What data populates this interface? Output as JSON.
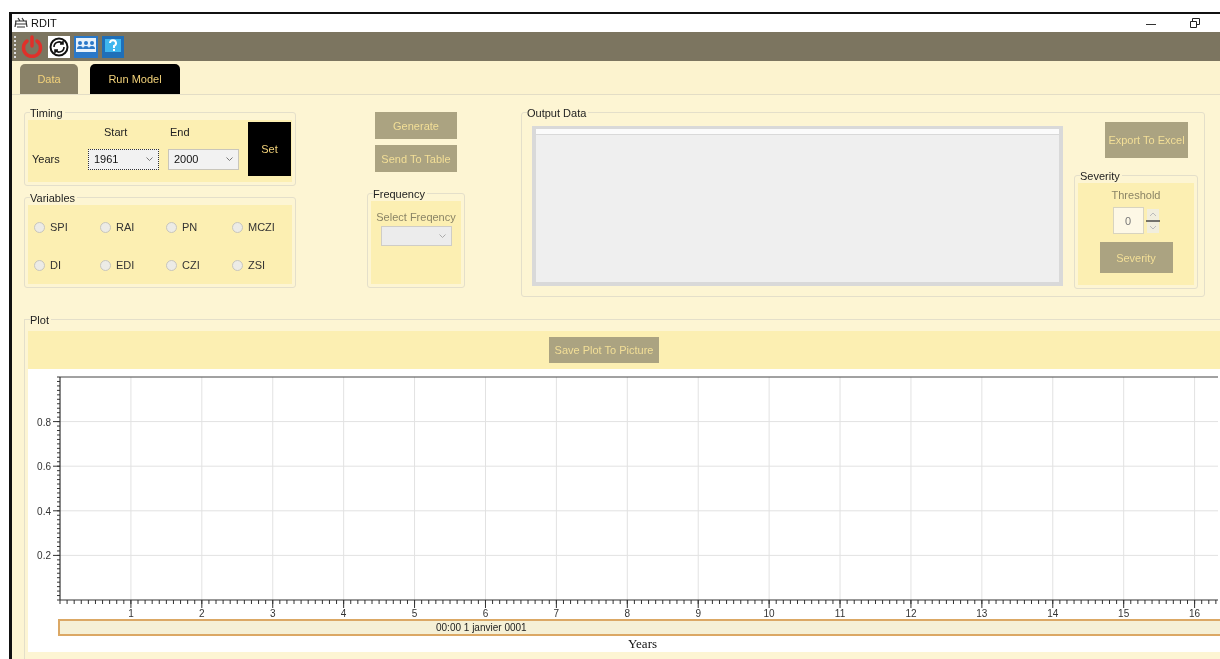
{
  "window": {
    "title": "RDIT"
  },
  "tabs": [
    {
      "label": "Data",
      "selected": false
    },
    {
      "label": "Run Model",
      "selected": true
    }
  ],
  "timing": {
    "title": "Timing",
    "start_label": "Start",
    "end_label": "End",
    "row_label": "Years",
    "start": {
      "value": "1961",
      "focused": true
    },
    "end": {
      "value": "2000",
      "focused": false
    },
    "set_button": {
      "label": "Set",
      "disabled": false
    }
  },
  "variables": {
    "title": "Variables",
    "options": [
      {
        "label": "SPI",
        "selected": false
      },
      {
        "label": "RAI",
        "selected": false
      },
      {
        "label": "PN",
        "selected": false
      },
      {
        "label": "MCZI",
        "selected": false
      },
      {
        "label": "DI",
        "selected": false
      },
      {
        "label": "EDI",
        "selected": false
      },
      {
        "label": "CZI",
        "selected": false
      },
      {
        "label": "ZSI",
        "selected": false
      }
    ]
  },
  "actions": [
    {
      "label": "Generate",
      "disabled": true
    },
    {
      "label": "Send To Table",
      "disabled": true
    }
  ],
  "frequency": {
    "title": "Frequency",
    "label": "Select Freqency",
    "select": {
      "disabled": true
    }
  },
  "output": {
    "title": "Output Data",
    "export_button": {
      "label": "Export To Excel",
      "disabled": true
    },
    "severity": {
      "title": "Severity",
      "threshold_label": "Threshold",
      "threshold_value": "0",
      "button": {
        "label": "Severity",
        "disabled": true
      }
    }
  },
  "plot": {
    "title": "Plot",
    "save_button": {
      "label": "Save Plot To Picture",
      "disabled": true
    },
    "date_label": "00:00 1 janvier 0001",
    "chart_data": {
      "type": "line",
      "grid": true,
      "xlabel": "Years",
      "xlim": [
        0,
        16.33
      ],
      "ylim": [
        0,
        1
      ],
      "xticks": [
        1,
        2,
        3,
        4,
        5,
        6,
        7,
        8,
        9,
        10,
        11,
        12,
        13,
        14,
        15,
        16
      ],
      "yticks": [
        0.2,
        0.4,
        0.6,
        0.8
      ]
    }
  }
}
